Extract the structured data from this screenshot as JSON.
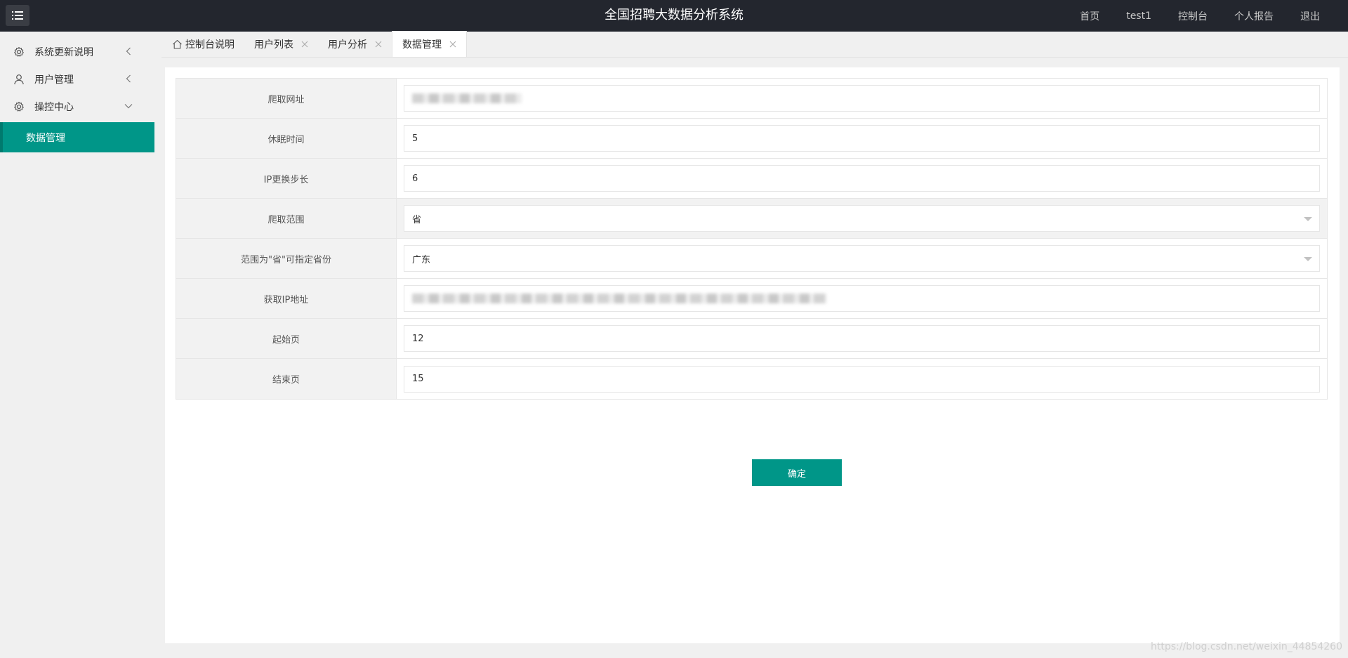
{
  "header": {
    "title": "全国招聘大数据分析系统",
    "menu_icon": "hamburger-menu-icon",
    "nav": [
      {
        "label": "首页"
      },
      {
        "label": "test1"
      },
      {
        "label": "控制台"
      },
      {
        "label": "个人报告"
      },
      {
        "label": "退出"
      }
    ]
  },
  "sidebar": {
    "items": [
      {
        "label": "系统更新说明",
        "icon": "gear-icon",
        "arrow": "chevron-left-icon"
      },
      {
        "label": "用户管理",
        "icon": "user-icon",
        "arrow": "chevron-left-icon"
      },
      {
        "label": "操控中心",
        "icon": "gear-icon",
        "arrow": "chevron-down-icon"
      }
    ],
    "active_sub": {
      "label": "数据管理"
    }
  },
  "tabs": [
    {
      "label": "控制台说明",
      "icon": "home-icon"
    },
    {
      "label": "用户列表"
    },
    {
      "label": "用户分析"
    },
    {
      "label": "数据管理"
    }
  ],
  "form": {
    "rows": [
      {
        "label": "爬取网址",
        "value": ""
      },
      {
        "label": "休眠时间",
        "value": "5"
      },
      {
        "label": "IP更换步长",
        "value": "6"
      },
      {
        "label": "爬取范围",
        "value": "省"
      },
      {
        "label": "范围为\"省\"可指定省份",
        "value": "广东"
      },
      {
        "label": "获取IP地址",
        "value": ""
      },
      {
        "label": "起始页",
        "value": "12"
      },
      {
        "label": "结束页",
        "value": "15"
      }
    ],
    "submit_label": "确定"
  },
  "watermark": "https://blog.csdn.net/weixin_44854260",
  "colors": {
    "header_bg": "#23262e",
    "accent": "#009688"
  }
}
